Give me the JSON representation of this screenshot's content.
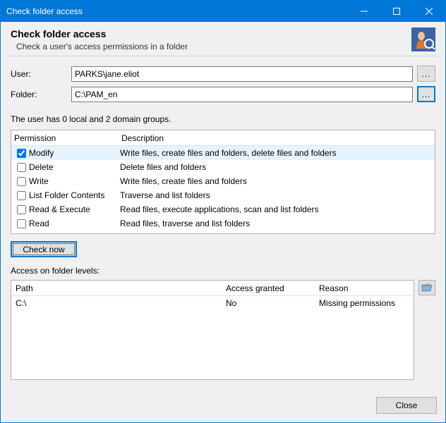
{
  "window": {
    "title": "Check folder access"
  },
  "header": {
    "title": "Check folder access",
    "subtitle": "Check a user's access permissions in a folder"
  },
  "form": {
    "user_label": "User:",
    "user_value": "PARKS\\jane.eliot",
    "folder_label": "Folder:",
    "folder_value": "C:\\PAM_en",
    "browse_label": "..."
  },
  "status_text": "The user has 0 local and 2 domain groups.",
  "perm": {
    "col_permission": "Permission",
    "col_description": "Description",
    "rows": [
      {
        "name": "Modify",
        "desc": "Write files, create files and folders, delete files and folders",
        "checked": true
      },
      {
        "name": "Delete",
        "desc": "Delete files and folders",
        "checked": false
      },
      {
        "name": "Write",
        "desc": "Write files, create files and folders",
        "checked": false
      },
      {
        "name": "List Folder Contents",
        "desc": "Traverse and list folders",
        "checked": false
      },
      {
        "name": "Read & Execute",
        "desc": "Read files, execute applications, scan and list folders",
        "checked": false
      },
      {
        "name": "Read",
        "desc": "Read files, traverse and list folders",
        "checked": false
      }
    ]
  },
  "check_now_label": "Check now",
  "access": {
    "label": "Access on folder levels:",
    "col_path": "Path",
    "col_granted": "Access granted",
    "col_reason": "Reason",
    "rows": [
      {
        "path": "C:\\",
        "granted": "No",
        "reason": "Missing permissions"
      }
    ]
  },
  "close_label": "Close"
}
